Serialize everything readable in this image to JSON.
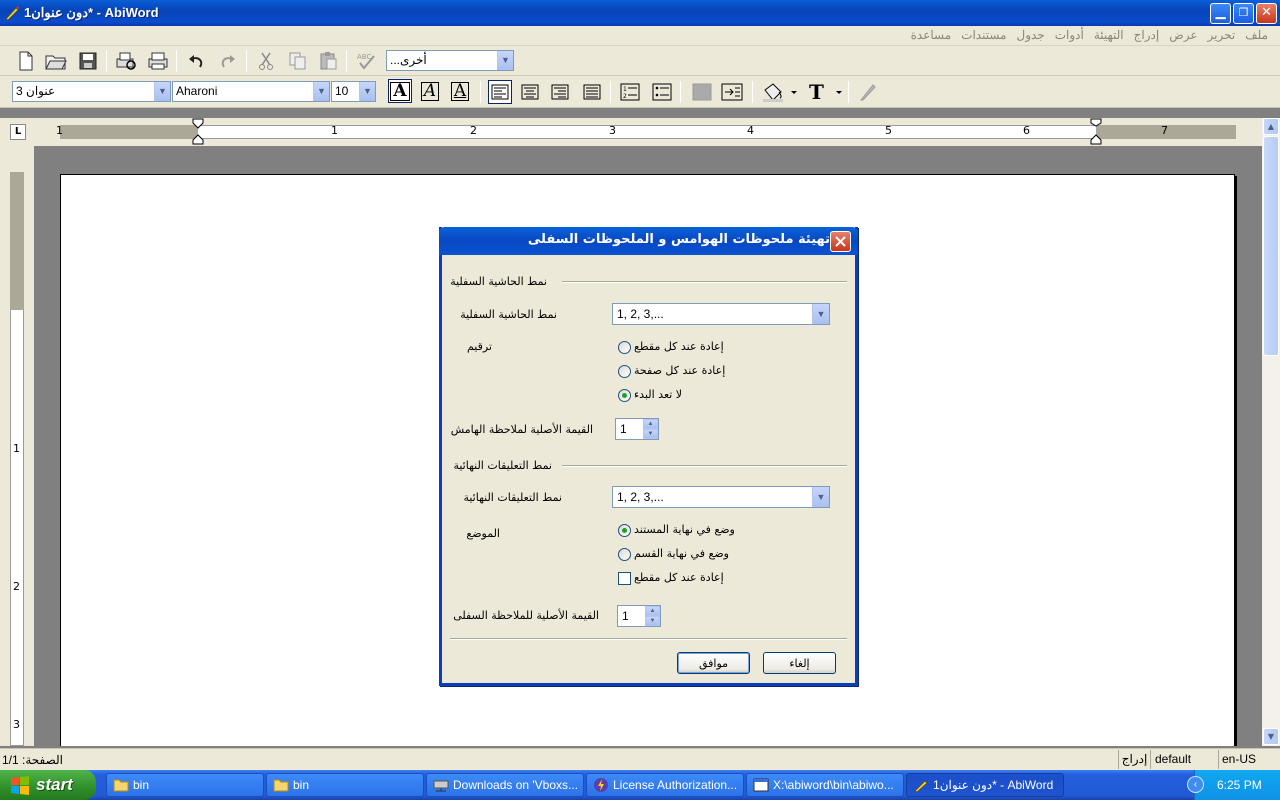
{
  "window": {
    "title": "دون عنوان1* - AbiWord"
  },
  "menu": [
    "ملف",
    "تحرير",
    "عرض",
    "إدراج",
    "التهيئة",
    "أدوات",
    "جدول",
    "مستندات",
    "مساعدة"
  ],
  "toolbar": {
    "style_combo": "أخرى...",
    "paragraph_style": "عنوان 3",
    "font_name": "Aharoni",
    "font_size": "10"
  },
  "ruler": {
    "h_labels": [
      "1",
      "1",
      "2",
      "3",
      "4",
      "5",
      "6",
      "7"
    ],
    "v_labels": [
      "1",
      "2",
      "3"
    ]
  },
  "dialog": {
    "title": "تهيئة ملحوظات الهوامس و الملحوظات السفلى",
    "footnote_section": "نمط الحاشية السفلية",
    "footnote_style_label": "نمط الحاشية السفلية",
    "footnote_style_value": "1, 2, 3,...",
    "numbering_label": "ترقيم",
    "numbering_options": [
      {
        "label": "إعادة عند كل مقطع",
        "selected": false
      },
      {
        "label": "إعادة عند كل صفحة",
        "selected": false
      },
      {
        "label": "لا تعد البدء",
        "selected": true
      }
    ],
    "footnote_initial_label": "القيمة الأصلية لملاحظة الهامش",
    "footnote_initial_value": "1",
    "endnote_section": "نمط التعليقات النهائية",
    "endnote_style_label": "نمط التعليقات النهائية",
    "endnote_style_value": "1, 2, 3,...",
    "position_label": "الموضع",
    "position_options": [
      {
        "label": "وضع في نهاية المستند",
        "selected": true
      },
      {
        "label": "وضع في نهاية القسم",
        "selected": false
      }
    ],
    "restart_section_label": "إعادة عند كل مقطع",
    "restart_section_checked": false,
    "endnote_initial_label": "القيمة الأصلية للملاحظة السفلى",
    "endnote_initial_value": "1",
    "ok_label": "موافق",
    "cancel_label": "إلغاء"
  },
  "status": {
    "page": "الصفحة: 1/1",
    "mode": "إدراج",
    "style": "default",
    "lang": "en-US"
  },
  "taskbar": {
    "start_label": "start",
    "items": [
      "bin",
      "bin",
      "Downloads on 'Vboxs...",
      "License Authorization...",
      "X:\\abiword\\bin\\abiwo...",
      "دون عنوان1* - AbiWord"
    ],
    "clock": "6:25 PM"
  }
}
